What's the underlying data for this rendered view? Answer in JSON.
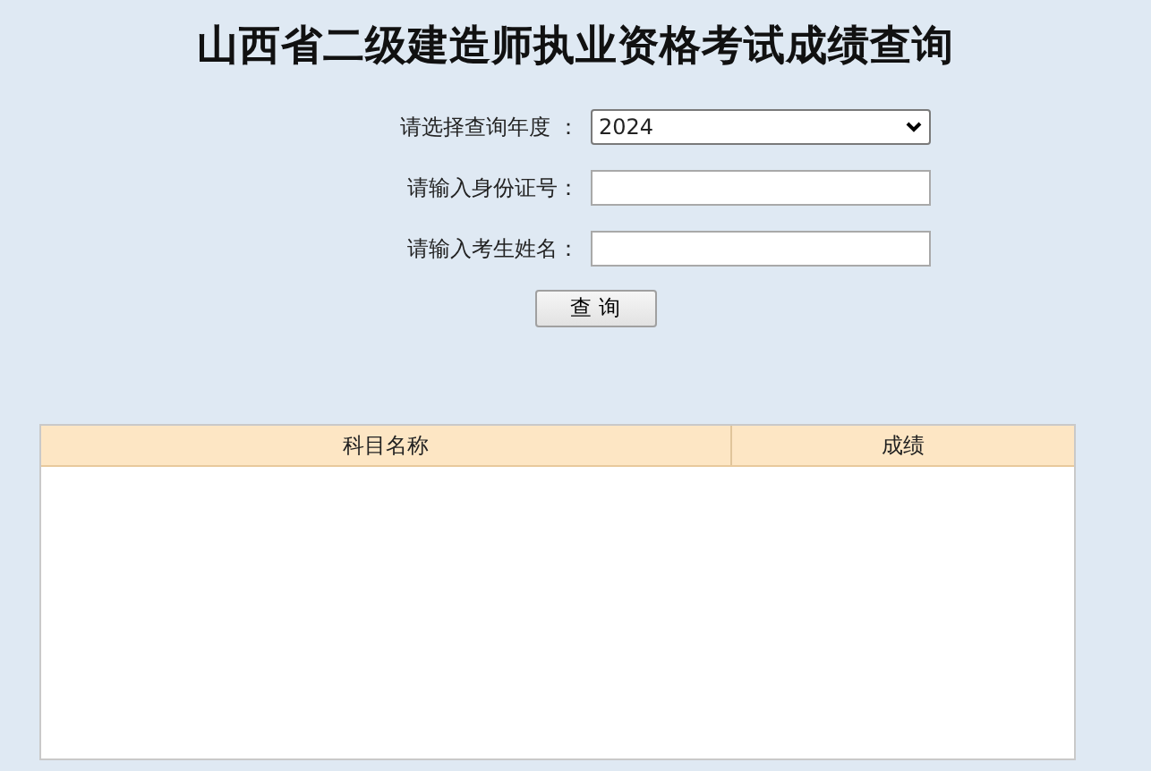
{
  "title": "山西省二级建造师执业资格考试成绩查询",
  "form": [
    {
      "kind": "select",
      "label": "请选择查询年度 ：",
      "value": "2024"
    },
    {
      "kind": "input",
      "label": "请输入身份证号："
    },
    {
      "kind": "input",
      "label": "请输入考生姓名："
    }
  ],
  "submit_button": "查 询",
  "table": {
    "columns": [
      "科目名称",
      "成绩"
    ]
  }
}
